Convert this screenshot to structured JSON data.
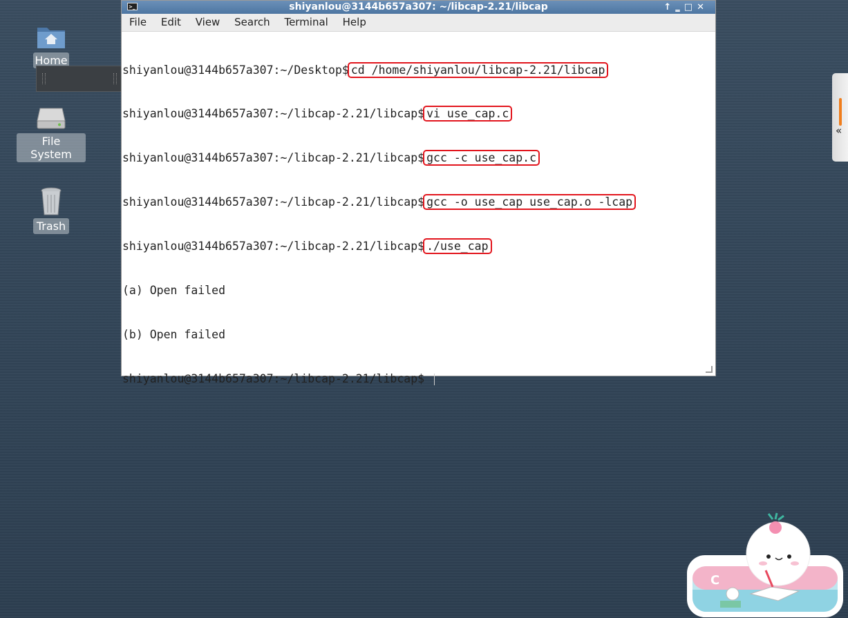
{
  "desktop": {
    "icons": [
      {
        "label": "Home",
        "icon": "home-folder-icon"
      },
      {
        "label": "File System",
        "icon": "hard-drive-icon"
      },
      {
        "label": "Trash",
        "icon": "trash-icon"
      }
    ]
  },
  "terminal": {
    "title": "shiyanlou@3144b657a307: ~/libcap-2.21/libcap",
    "window_controls": [
      "↑",
      "‗",
      "□",
      "✕"
    ],
    "menu": [
      "File",
      "Edit",
      "View",
      "Search",
      "Terminal",
      "Help"
    ],
    "lines": [
      {
        "prompt": "shiyanlou@3144b657a307:~/Desktop$",
        "command": "cd /home/shiyanlou/libcap-2.21/libcap"
      },
      {
        "prompt": "shiyanlou@3144b657a307:~/libcap-2.21/libcap$",
        "command": "vi use_cap.c"
      },
      {
        "prompt": "shiyanlou@3144b657a307:~/libcap-2.21/libcap$",
        "command": "gcc -c use_cap.c"
      },
      {
        "prompt": "shiyanlou@3144b657a307:~/libcap-2.21/libcap$",
        "command": "gcc -o use_cap use_cap.o -lcap"
      },
      {
        "prompt": "shiyanlou@3144b657a307:~/libcap-2.21/libcap$",
        "command": "./use_cap"
      }
    ],
    "output": [
      "(a) Open failed",
      "(b) Open failed"
    ],
    "final_prompt": "shiyanlou@3144b657a307:~/libcap-2.21/libcap$"
  },
  "colors": {
    "highlight_box": "#e2141c",
    "titlebar": "#5b82ad",
    "side_accent": "#f07d1b"
  },
  "side_panel": {
    "chevron": "«"
  },
  "mascot": {
    "letter": "C"
  }
}
